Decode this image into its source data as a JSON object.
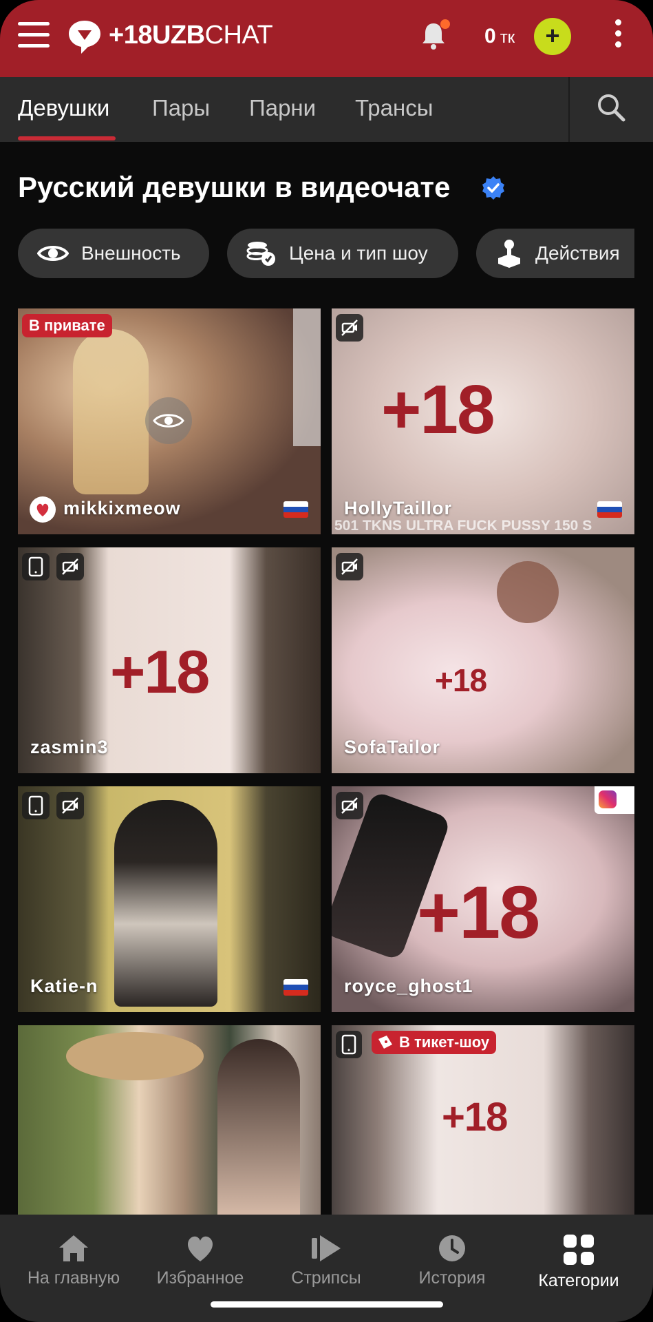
{
  "header": {
    "logo_brand": "+18UZB",
    "logo_suffix": "CHAT",
    "token_count": "0",
    "token_unit": "тк",
    "add_label": "+"
  },
  "tabs": [
    {
      "label": "Девушки",
      "active": true
    },
    {
      "label": "Пары",
      "active": false
    },
    {
      "label": "Парни",
      "active": false
    },
    {
      "label": "Трансы",
      "active": false
    }
  ],
  "page_title": "Русский девушки в видеочате",
  "filters": [
    {
      "label": "Внешность",
      "icon": "eye-icon"
    },
    {
      "label": "Цена и тип шоу",
      "icon": "coins-icon"
    },
    {
      "label": "Действия",
      "icon": "joystick-icon"
    }
  ],
  "cards": [
    {
      "name": "mikkixmeow",
      "badge": "В привате",
      "flag": "ru",
      "favorite": true
    },
    {
      "name": "HollyTaillor",
      "overlay": "+18",
      "caption": "501 TKNS ULTRA FUCK PUSSY 150 S",
      "flag": "ru"
    },
    {
      "name": "zasmin3",
      "overlay": "+18"
    },
    {
      "name": "SofaTailor",
      "overlay": "+18"
    },
    {
      "name": "Katie-n",
      "flag": "ru"
    },
    {
      "name": "royce_ghost1",
      "overlay": "+18"
    },
    {
      "name": ""
    },
    {
      "name": "",
      "badge": "В тикет-шоу",
      "overlay": "+18"
    }
  ],
  "bottom_nav": [
    {
      "label": "На главную",
      "icon": "home-icon"
    },
    {
      "label": "Избранное",
      "icon": "heart-icon"
    },
    {
      "label": "Стрипсы",
      "icon": "play-icon"
    },
    {
      "label": "История",
      "icon": "clock-icon"
    },
    {
      "label": "Категории",
      "icon": "grid-icon",
      "active": true
    }
  ],
  "colors": {
    "brand": "#a11f28",
    "accent_add": "#c8dc1c",
    "tab_underline": "#c92b36"
  }
}
